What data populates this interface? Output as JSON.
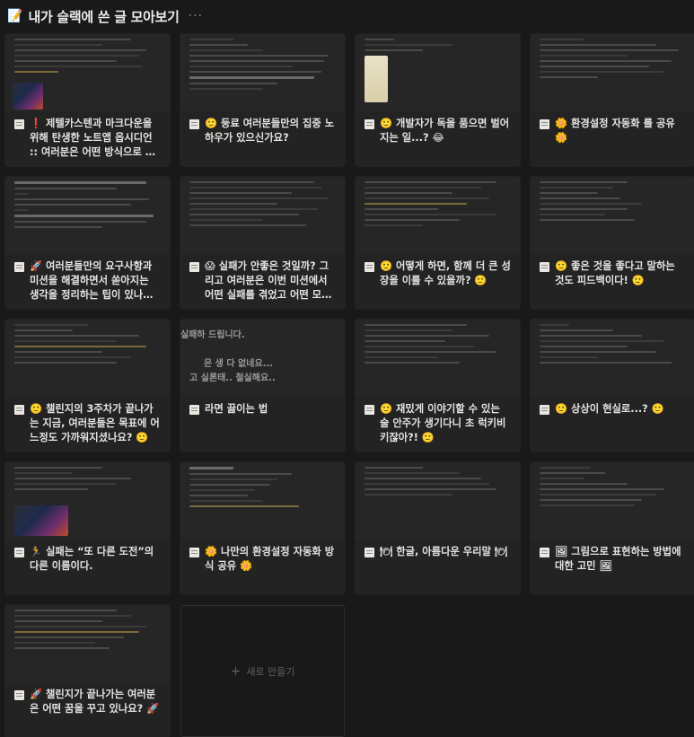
{
  "header": {
    "page_icon": "memo-icon",
    "page_icon_glyph": "📝",
    "title": "내가 슬랙에 쓴 글 모아보기",
    "more_label": "···"
  },
  "cards": [
    {
      "title": "❗ 제텔카스텐과 마크다운을 위해 탄생한 노트앱 옵시디언 :: 여러분은 어떤 방식으로 생각을 정리하고 계신가요? ❗"
    },
    {
      "title": "🙂 둥료 여러분들만의 집중 노하우가 있으신가요?"
    },
    {
      "title": "🙂 개발자가 독을 품으면 벌어지는 일...? 😂"
    },
    {
      "title": "🌼 환경설정 자동화 를 공유 🌼"
    },
    {
      "title": "🚀 여러분들만의 요구사항과 미션을 해결하면서 쏟아지는 생각을 정리하는 팁이 있나요? 🚀"
    },
    {
      "title": "😱 실패가 안좋은 것일까? 그리고 여러분은 이번 미션에서 어떤 실패를 겪었고 어떤 모습을 보이셨나요? 😱"
    },
    {
      "title": "🙂 어떻게 하면, 함께 더 큰 성장을 이룰 수 있을까? 🙂"
    },
    {
      "title": "🙂 좋은 것을 좋다고 말하는 것도 피드백이다! 🙂"
    },
    {
      "title": "🙂 챌린지의 3주차가 끝나가는 지금, 여러분들은 목표에 어느정도 가까워지셨나요? 🙂"
    },
    {
      "title": "라면 끓이는 법"
    },
    {
      "title": "🙂 재밌게 이야기할 수 있는 술 안주가 생기다니 초 럭키비키잖아?! 🙂"
    },
    {
      "title": "🙂 상상이 현실로...? 🙂"
    },
    {
      "title": "🏃 실패는 “또 다른 도전”의 다른 이름이다."
    },
    {
      "title": "🌼 나만의 환경설정 자동화 방식 공유 🌼"
    },
    {
      "title": "🍽 한글, 아름다운 우리말 🍽"
    },
    {
      "title": "🖼 그림으로 표현하는 방법에 대한 고민 🖼"
    },
    {
      "title": "🚀 챌린지가 끝나가는 여러분은 어떤 꿈을 꾸고 있나요? 🚀"
    }
  ],
  "thumb_snippets": {
    "card10": [
      "실패하 드립니다.",
      "은 생 다 없네요...",
      "고 실론태.. 철실해요.."
    ]
  },
  "new_card": {
    "label": "새로 만들기",
    "icon": "plus-icon",
    "glyph": "+"
  },
  "colors": {
    "background": "#191919",
    "card": "#232323",
    "text": "#e4e4e2",
    "muted": "#5f5f5d"
  }
}
